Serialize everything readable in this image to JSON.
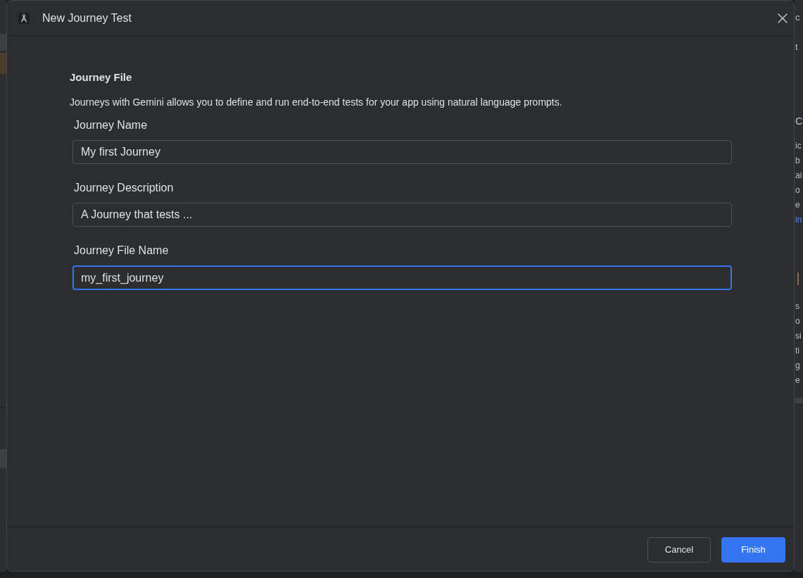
{
  "background": {
    "editor_fragments": [
      {
        "kind": "toolbar",
        "lines": [
          {
            "text": "c",
            "kind": "text"
          }
        ]
      },
      {
        "kind": "toolbar",
        "lines": [
          {
            "text": "t",
            "kind": "text"
          }
        ]
      },
      {
        "kind": "heading",
        "lines": [
          {
            "text": "C",
            "kind": "text"
          }
        ]
      },
      {
        "kind": "paragraph",
        "lines": [
          {
            "text": "ic",
            "kind": "text"
          },
          {
            "text": "b",
            "kind": "text"
          },
          {
            "text": "ai",
            "kind": "text"
          },
          {
            "text": "o",
            "kind": "text"
          },
          {
            "text": "e",
            "kind": "text"
          },
          {
            "text": "in",
            "kind": "link"
          }
        ]
      },
      {
        "kind": "bar"
      },
      {
        "kind": "paragraph",
        "lines": [
          {
            "text": "s",
            "kind": "text"
          },
          {
            "text": "o",
            "kind": "text"
          },
          {
            "text": "si",
            "kind": "text"
          },
          {
            "text": "ti",
            "kind": "text"
          },
          {
            "text": "g",
            "kind": "text"
          },
          {
            "text": "e",
            "kind": "text"
          }
        ]
      }
    ]
  },
  "dialog": {
    "title": "New Journey Test",
    "section": {
      "title": "Journey File",
      "description": "Journeys with Gemini allows you to define and run end-to-end tests for your app using natural language prompts."
    },
    "fields": [
      {
        "label": "Journey Name",
        "value": "My first Journey",
        "focused": false
      },
      {
        "label": "Journey Description",
        "value": "A Journey that tests ...",
        "focused": false
      },
      {
        "label": "Journey File Name",
        "value": "my_first_journey",
        "focused": true
      }
    ],
    "buttons": [
      {
        "label": "Cancel",
        "kind": "secondary"
      },
      {
        "label": "Finish",
        "kind": "primary"
      }
    ]
  }
}
